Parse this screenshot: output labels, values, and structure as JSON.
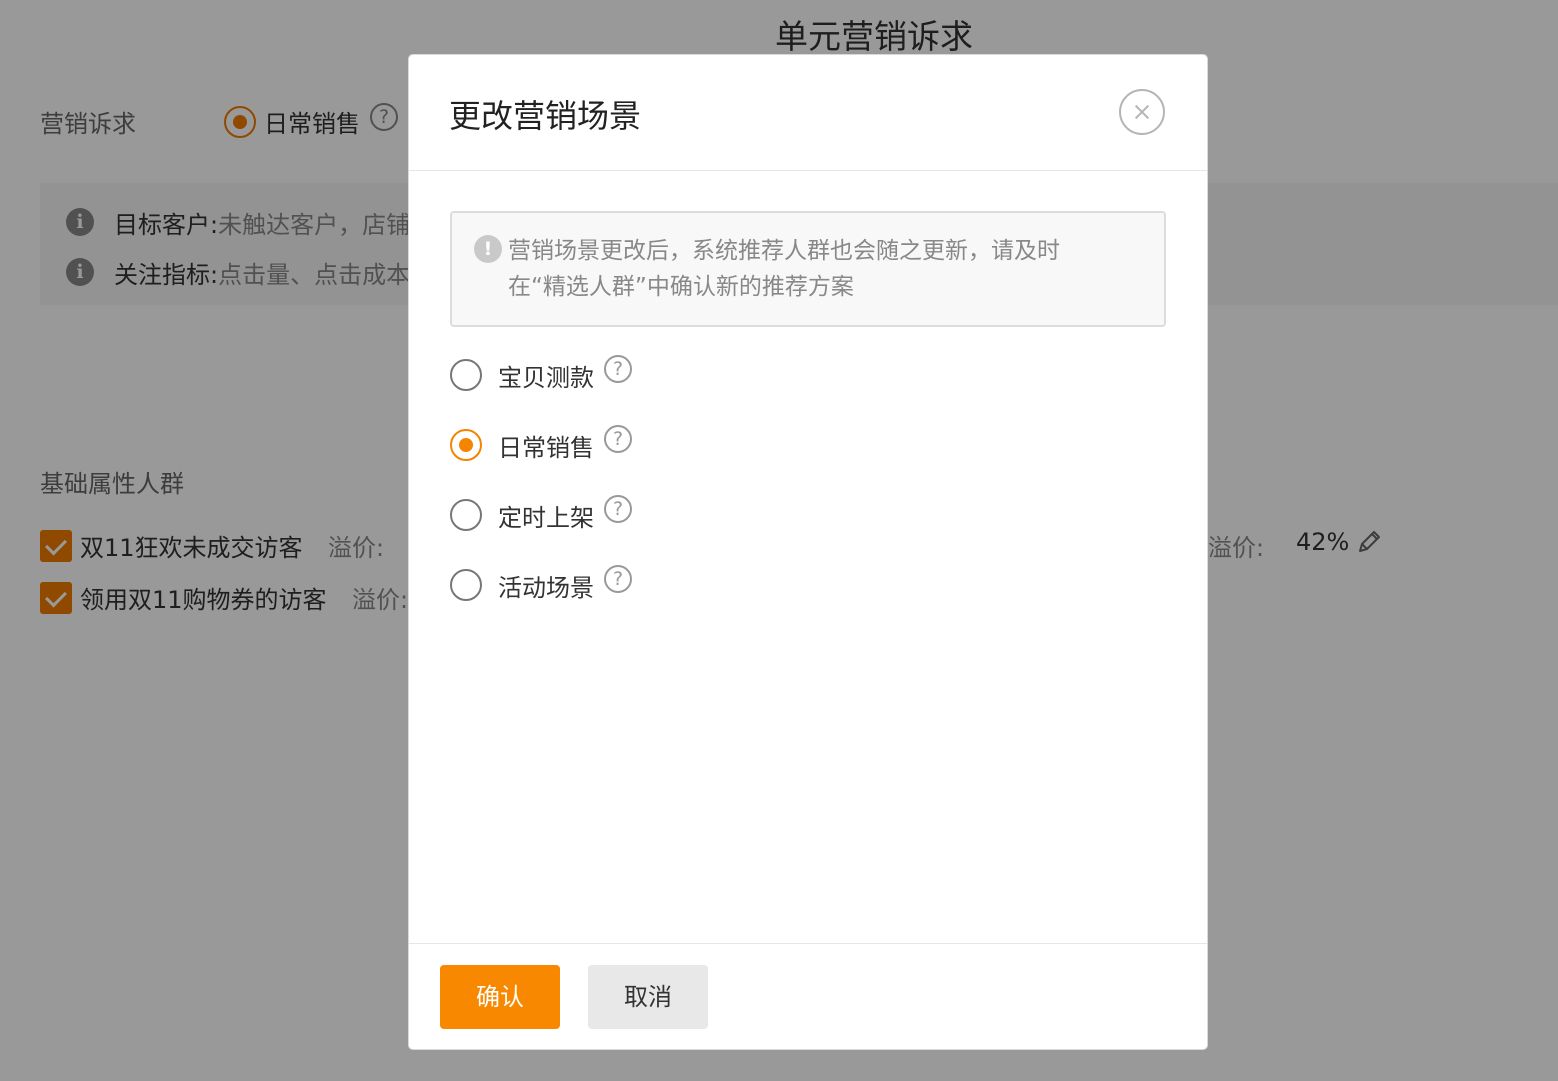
{
  "background": {
    "page_title": "单元营销诉求",
    "appeal_label": "营销诉求",
    "appeal_selected": "日常销售",
    "info": [
      {
        "label": "目标客户:",
        "value": "未触达客户，店铺"
      },
      {
        "label": "关注指标:",
        "value": "点击量、点击成本"
      }
    ],
    "crowd_section_title": "基础属性人群",
    "crowds": [
      {
        "name": "双11狂欢未成交访客",
        "premium_label": "溢价:"
      },
      {
        "name": "领用双11购物券的访客",
        "premium_label": "溢价:"
      }
    ],
    "right_premium_label": "溢价:",
    "right_premium_value": "42%"
  },
  "modal": {
    "title": "更改营销场景",
    "notice": "营销场景更改后，系统推荐人群也会随之更新，请及时在“精选人群”中确认新的推荐方案",
    "options": [
      {
        "label": "宝贝测款",
        "checked": false
      },
      {
        "label": "日常销售",
        "checked": true
      },
      {
        "label": "定时上架",
        "checked": false
      },
      {
        "label": "活动场景",
        "checked": false
      }
    ],
    "confirm_label": "确认",
    "cancel_label": "取消"
  },
  "colors": {
    "accent": "#f58400",
    "overlay": "rgba(0,0,0,0.40)"
  }
}
